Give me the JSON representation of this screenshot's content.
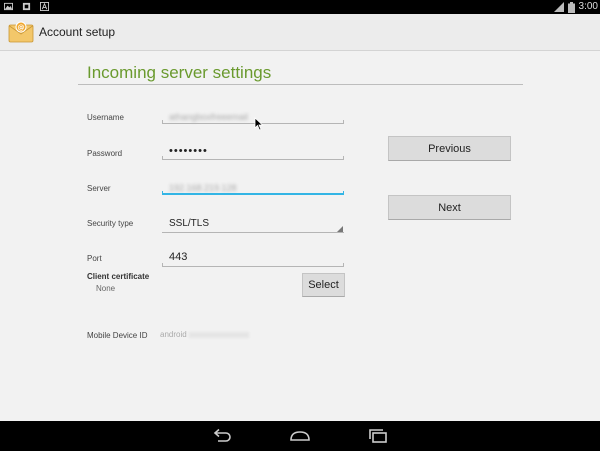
{
  "status_bar": {
    "time": "3:00",
    "icons": [
      "gallery-icon",
      "screenshot-icon",
      "a-icon",
      "signal-icon",
      "battery-icon"
    ]
  },
  "action_bar": {
    "title": "Account setup",
    "icon": "email-app-icon"
  },
  "main": {
    "heading": "Incoming server settings",
    "fields": {
      "username": {
        "label": "Username",
        "value": "athangboxfreeemail"
      },
      "password": {
        "label": "Password",
        "value": "••••••••"
      },
      "server": {
        "label": "Server",
        "value": "192.168.219.128"
      },
      "security_type": {
        "label": "Security type",
        "value": "SSL/TLS"
      },
      "port": {
        "label": "Port",
        "value": "443"
      }
    },
    "client_certificate": {
      "label": "Client certificate",
      "value": "None",
      "select_label": "Select"
    },
    "mobile_device_id": {
      "label": "Mobile Device ID",
      "value": "android"
    }
  },
  "buttons": {
    "previous": "Previous",
    "next": "Next"
  },
  "nav_bar": {
    "icons": [
      "back-icon",
      "home-icon",
      "recents-icon"
    ]
  },
  "colors": {
    "accent": "#33b5e5",
    "heading": "#6a9a2e"
  }
}
